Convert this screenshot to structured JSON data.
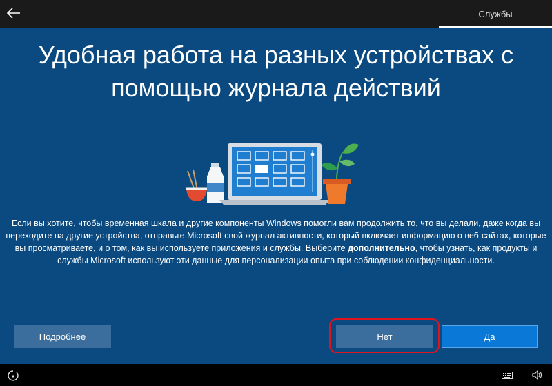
{
  "header": {
    "back_icon": "back-arrow-icon",
    "step_label": "Службы"
  },
  "main": {
    "title": "Удобная работа на разных устройствах с помощью журнала действий",
    "description_part1": "Если вы хотите, чтобы временная шкала и другие компоненты Windows помогли вам продолжить то, что вы делали, даже когда вы переходите на другие устройства, отправьте Microsoft свой журнал активности, который включает информацию о веб-сайтах, которые вы просматриваете, и о том, как вы используете приложения и службы. Выберите ",
    "description_bold": "дополнительно",
    "description_part2": ", чтобы узнать, как продукты и службы Microsoft используют эти данные для персонализации опыта при соблюдении конфиденциальности."
  },
  "buttons": {
    "more": "Подробнее",
    "no": "Нет",
    "yes": "Да"
  },
  "taskbar": {
    "icons": [
      "ease-of-access-icon",
      "keyboard-icon",
      "volume-icon"
    ]
  },
  "colors": {
    "background": "#0b4a80",
    "primary_button": "#0a78d7",
    "secondary_button": "#3b6e9c",
    "highlight": "#e0141e"
  }
}
